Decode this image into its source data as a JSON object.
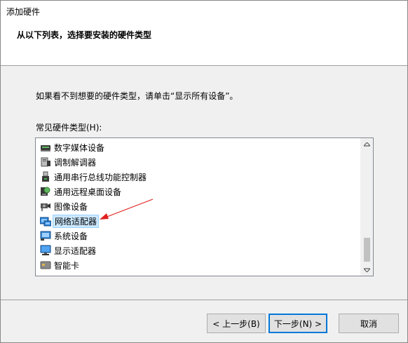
{
  "window": {
    "title": "添加硬件"
  },
  "header": {
    "heading": "从以下列表，选择要安装的硬件类型"
  },
  "content": {
    "hint": "如果看不到想要的硬件类型，请单击“显示所有设备”。",
    "list_label": "常见硬件类型(H):"
  },
  "hardware_list": {
    "items": [
      {
        "label": "数字媒体设备",
        "icon": "media-device-icon"
      },
      {
        "label": "调制解调器",
        "icon": "modem-icon"
      },
      {
        "label": "通用串行总线功能控制器",
        "icon": "usb-controller-icon"
      },
      {
        "label": "通用远程桌面设备",
        "icon": "remote-desktop-icon"
      },
      {
        "label": "图像设备",
        "icon": "camera-icon"
      },
      {
        "label": "网络适配器",
        "icon": "network-adapter-icon",
        "selected": true
      },
      {
        "label": "系统设备",
        "icon": "system-device-icon"
      },
      {
        "label": "显示适配器",
        "icon": "display-adapter-icon"
      },
      {
        "label": "智能卡",
        "icon": "smart-card-icon"
      }
    ],
    "scroll_position": 0.85
  },
  "buttons": {
    "back": "< 上一步(B)",
    "next": "下一步(N) >",
    "cancel": "取消"
  },
  "colors": {
    "selection": "#cce8ff",
    "accent": "#0078d7",
    "annotation_arrow": "#e02020"
  }
}
